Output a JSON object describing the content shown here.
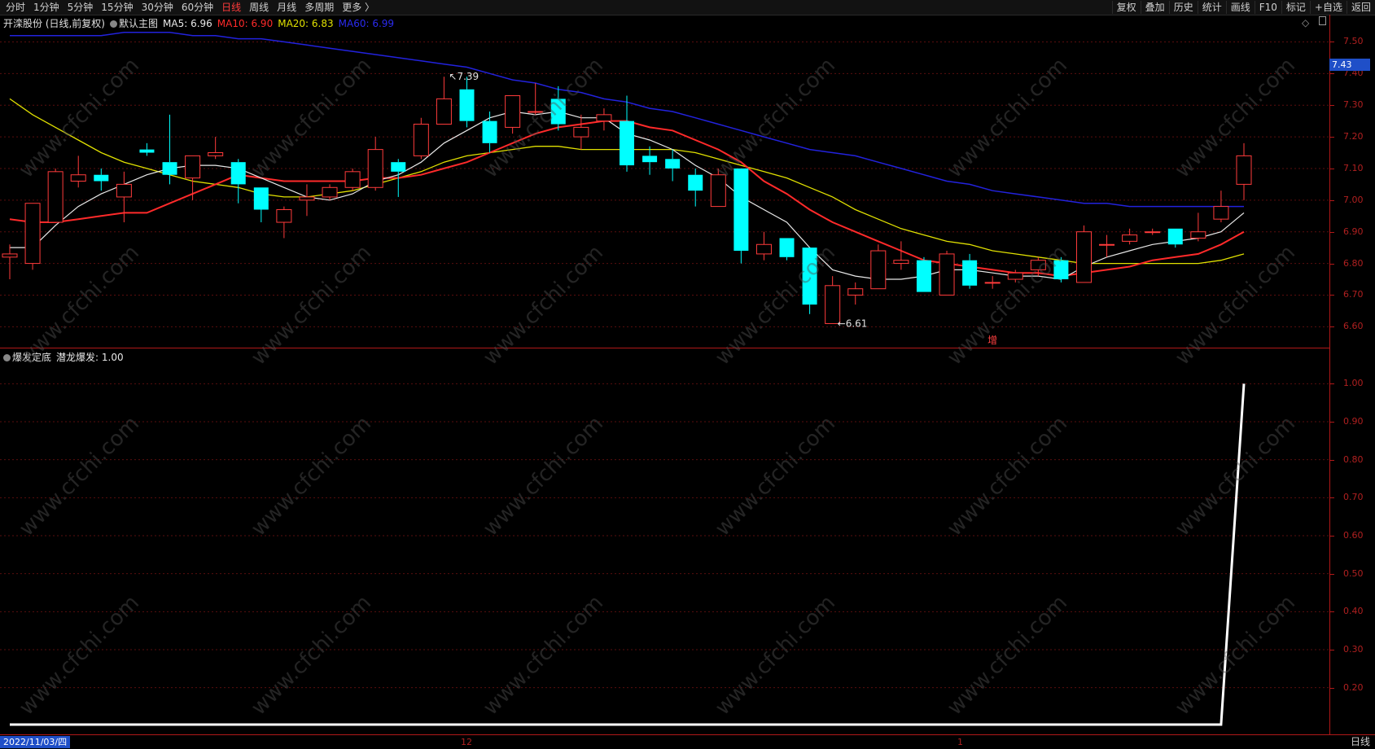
{
  "toolbar": {
    "tabs": [
      "分时",
      "1分钟",
      "5分钟",
      "15分钟",
      "30分钟",
      "60分钟",
      "日线",
      "周线",
      "月线",
      "多周期",
      "更多 〉"
    ],
    "active_tab": "日线",
    "tools": [
      "复权",
      "叠加",
      "历史",
      "统计",
      "画线",
      "F10",
      "标记",
      "+自选",
      "返回"
    ]
  },
  "info": {
    "stock": "开滦股份 (日线,前复权)",
    "main_chart": "默认主图",
    "ma5": "MA5: 6.96",
    "ma10": "MA10: 6.90",
    "ma20": "MA20: 6.83",
    "ma60": "MA60: 6.99"
  },
  "indicator": {
    "name": "爆发定底",
    "value": "潜龙爆发: 1.00"
  },
  "price_axis": [
    "7.50",
    "7.40",
    "7.30",
    "7.20",
    "7.10",
    "7.00",
    "6.90",
    "6.80",
    "6.70",
    "6.60"
  ],
  "current_price": "7.43",
  "indicator_axis": [
    "1.00",
    "0.90",
    "0.80",
    "0.70",
    "0.60",
    "0.50",
    "0.40",
    "0.30",
    "0.20"
  ],
  "x_axis": {
    "date": "2022/11/03/四",
    "ticks": [
      "12",
      "1"
    ]
  },
  "period_label": "日线",
  "annotations": {
    "high": "7.39",
    "low": "6.61",
    "tag": "增"
  },
  "watermark": "www.cfchi.com",
  "colors": {
    "up": "#ff3b3b",
    "down": "#00ffff",
    "ma5": "#e8e8e8",
    "ma10": "#ff2a2a",
    "ma20": "#e0e000",
    "ma60": "#2222dd"
  },
  "chart_data": {
    "type": "candlestick",
    "price_range": [
      6.57,
      7.55
    ],
    "candles": [
      {
        "o": 6.82,
        "h": 6.86,
        "l": 6.75,
        "c": 6.83
      },
      {
        "o": 6.8,
        "h": 6.99,
        "l": 6.78,
        "c": 6.99
      },
      {
        "o": 6.93,
        "h": 7.1,
        "l": 6.93,
        "c": 7.09
      },
      {
        "o": 7.06,
        "h": 7.14,
        "l": 7.04,
        "c": 7.08
      },
      {
        "o": 7.08,
        "h": 7.1,
        "l": 7.03,
        "c": 7.06
      },
      {
        "o": 7.01,
        "h": 7.09,
        "l": 6.93,
        "c": 7.05
      },
      {
        "o": 7.16,
        "h": 7.18,
        "l": 7.14,
        "c": 7.15
      },
      {
        "o": 7.12,
        "h": 7.27,
        "l": 7.05,
        "c": 7.08
      },
      {
        "o": 7.07,
        "h": 7.14,
        "l": 7.0,
        "c": 7.14
      },
      {
        "o": 7.14,
        "h": 7.2,
        "l": 7.13,
        "c": 7.15
      },
      {
        "o": 7.12,
        "h": 7.13,
        "l": 6.99,
        "c": 7.05
      },
      {
        "o": 7.04,
        "h": 7.04,
        "l": 6.93,
        "c": 6.97
      },
      {
        "o": 6.93,
        "h": 6.98,
        "l": 6.88,
        "c": 6.97
      },
      {
        "o": 7.0,
        "h": 7.05,
        "l": 6.95,
        "c": 7.01
      },
      {
        "o": 7.01,
        "h": 7.05,
        "l": 7.0,
        "c": 7.04
      },
      {
        "o": 7.04,
        "h": 7.1,
        "l": 7.03,
        "c": 7.09
      },
      {
        "o": 7.04,
        "h": 7.2,
        "l": 7.03,
        "c": 7.16
      },
      {
        "o": 7.12,
        "h": 7.13,
        "l": 7.01,
        "c": 7.09
      },
      {
        "o": 7.14,
        "h": 7.26,
        "l": 7.13,
        "c": 7.24
      },
      {
        "o": 7.24,
        "h": 7.39,
        "l": 7.24,
        "c": 7.32
      },
      {
        "o": 7.35,
        "h": 7.39,
        "l": 7.23,
        "c": 7.25
      },
      {
        "o": 7.25,
        "h": 7.28,
        "l": 7.15,
        "c": 7.18
      },
      {
        "o": 7.23,
        "h": 7.33,
        "l": 7.21,
        "c": 7.33
      },
      {
        "o": 7.28,
        "h": 7.37,
        "l": 7.27,
        "c": 7.28
      },
      {
        "o": 7.32,
        "h": 7.36,
        "l": 7.22,
        "c": 7.24
      },
      {
        "o": 7.2,
        "h": 7.27,
        "l": 7.16,
        "c": 7.23
      },
      {
        "o": 7.25,
        "h": 7.29,
        "l": 7.22,
        "c": 7.27
      },
      {
        "o": 7.25,
        "h": 7.33,
        "l": 7.09,
        "c": 7.11
      },
      {
        "o": 7.14,
        "h": 7.17,
        "l": 7.08,
        "c": 7.12
      },
      {
        "o": 7.13,
        "h": 7.16,
        "l": 7.06,
        "c": 7.1
      },
      {
        "o": 7.08,
        "h": 7.1,
        "l": 6.98,
        "c": 7.03
      },
      {
        "o": 6.98,
        "h": 7.1,
        "l": 6.98,
        "c": 7.08
      },
      {
        "o": 7.1,
        "h": 7.1,
        "l": 6.8,
        "c": 6.84
      },
      {
        "o": 6.83,
        "h": 6.9,
        "l": 6.81,
        "c": 6.86
      },
      {
        "o": 6.88,
        "h": 6.88,
        "l": 6.81,
        "c": 6.82
      },
      {
        "o": 6.85,
        "h": 6.85,
        "l": 6.64,
        "c": 6.67
      },
      {
        "o": 6.61,
        "h": 6.76,
        "l": 6.61,
        "c": 6.73
      },
      {
        "o": 6.7,
        "h": 6.74,
        "l": 6.67,
        "c": 6.72
      },
      {
        "o": 6.72,
        "h": 6.86,
        "l": 6.72,
        "c": 6.84
      },
      {
        "o": 6.8,
        "h": 6.87,
        "l": 6.78,
        "c": 6.81
      },
      {
        "o": 6.81,
        "h": 6.82,
        "l": 6.71,
        "c": 6.71
      },
      {
        "o": 6.7,
        "h": 6.84,
        "l": 6.7,
        "c": 6.83
      },
      {
        "o": 6.81,
        "h": 6.83,
        "l": 6.72,
        "c": 6.73
      },
      {
        "o": 6.74,
        "h": 6.76,
        "l": 6.72,
        "c": 6.74
      },
      {
        "o": 6.75,
        "h": 6.78,
        "l": 6.74,
        "c": 6.77
      },
      {
        "o": 6.78,
        "h": 6.82,
        "l": 6.76,
        "c": 6.81
      },
      {
        "o": 6.81,
        "h": 6.82,
        "l": 6.74,
        "c": 6.75
      },
      {
        "o": 6.74,
        "h": 6.92,
        "l": 6.74,
        "c": 6.9
      },
      {
        "o": 6.86,
        "h": 6.89,
        "l": 6.82,
        "c": 6.86
      },
      {
        "o": 6.87,
        "h": 6.91,
        "l": 6.86,
        "c": 6.89
      },
      {
        "o": 6.9,
        "h": 6.91,
        "l": 6.89,
        "c": 6.9
      },
      {
        "o": 6.91,
        "h": 6.91,
        "l": 6.85,
        "c": 6.86
      },
      {
        "o": 6.88,
        "h": 6.96,
        "l": 6.87,
        "c": 6.9
      },
      {
        "o": 6.94,
        "h": 7.03,
        "l": 6.93,
        "c": 6.98
      },
      {
        "o": 7.05,
        "h": 7.18,
        "l": 7.0,
        "c": 7.14
      }
    ],
    "ma5": [
      6.85,
      6.85,
      6.92,
      6.98,
      7.02,
      7.05,
      7.08,
      7.1,
      7.11,
      7.11,
      7.1,
      7.07,
      7.04,
      7.01,
      7.0,
      7.02,
      7.06,
      7.08,
      7.12,
      7.18,
      7.22,
      7.26,
      7.28,
      7.27,
      7.28,
      7.26,
      7.26,
      7.21,
      7.19,
      7.16,
      7.11,
      7.07,
      7.01,
      6.97,
      6.93,
      6.85,
      6.78,
      6.76,
      6.75,
      6.75,
      6.76,
      6.78,
      6.78,
      6.77,
      6.76,
      6.76,
      6.75,
      6.79,
      6.82,
      6.84,
      6.86,
      6.87,
      6.88,
      6.9,
      6.96
    ],
    "ma10": [
      6.94,
      6.93,
      6.93,
      6.94,
      6.95,
      6.96,
      6.96,
      6.99,
      7.02,
      7.05,
      7.08,
      7.07,
      7.06,
      7.06,
      7.06,
      7.06,
      7.07,
      7.07,
      7.08,
      7.1,
      7.12,
      7.15,
      7.18,
      7.21,
      7.23,
      7.24,
      7.25,
      7.25,
      7.23,
      7.22,
      7.19,
      7.16,
      7.12,
      7.06,
      7.02,
      6.97,
      6.93,
      6.9,
      6.87,
      6.84,
      6.81,
      6.8,
      6.79,
      6.78,
      6.77,
      6.77,
      6.76,
      6.77,
      6.78,
      6.79,
      6.81,
      6.82,
      6.83,
      6.86,
      6.9
    ],
    "ma20": [
      7.32,
      7.27,
      7.23,
      7.19,
      7.15,
      7.12,
      7.1,
      7.08,
      7.06,
      7.05,
      7.04,
      7.02,
      7.01,
      7.01,
      7.02,
      7.03,
      7.05,
      7.07,
      7.09,
      7.12,
      7.14,
      7.15,
      7.16,
      7.17,
      7.17,
      7.16,
      7.16,
      7.16,
      7.16,
      7.16,
      7.15,
      7.13,
      7.11,
      7.09,
      7.07,
      7.04,
      7.01,
      6.97,
      6.94,
      6.91,
      6.89,
      6.87,
      6.86,
      6.84,
      6.83,
      6.82,
      6.81,
      6.8,
      6.8,
      6.8,
      6.8,
      6.8,
      6.8,
      6.81,
      6.83
    ],
    "ma60": [
      7.52,
      7.52,
      7.52,
      7.52,
      7.52,
      7.53,
      7.53,
      7.53,
      7.52,
      7.52,
      7.51,
      7.51,
      7.5,
      7.49,
      7.48,
      7.47,
      7.46,
      7.45,
      7.44,
      7.43,
      7.42,
      7.4,
      7.38,
      7.37,
      7.35,
      7.34,
      7.32,
      7.31,
      7.29,
      7.28,
      7.26,
      7.24,
      7.22,
      7.2,
      7.18,
      7.16,
      7.15,
      7.14,
      7.12,
      7.1,
      7.08,
      7.06,
      7.05,
      7.03,
      7.02,
      7.01,
      7.0,
      6.99,
      6.99,
      6.98,
      6.98,
      6.98,
      6.98,
      6.98,
      6.98
    ],
    "indicator_range": [
      0.12,
      1.05
    ],
    "indicator_series": [
      0,
      0,
      0,
      0,
      0,
      0,
      0,
      0,
      0,
      0,
      0,
      0,
      0,
      0,
      0,
      0,
      0,
      0,
      0,
      0,
      0,
      0,
      0,
      0,
      0,
      0,
      0,
      0,
      0,
      0,
      0,
      0,
      0,
      0,
      0,
      0,
      0,
      0,
      0,
      0,
      0,
      0,
      0,
      0,
      0,
      0,
      0,
      0,
      0,
      0,
      0,
      0,
      0,
      0,
      1
    ]
  }
}
